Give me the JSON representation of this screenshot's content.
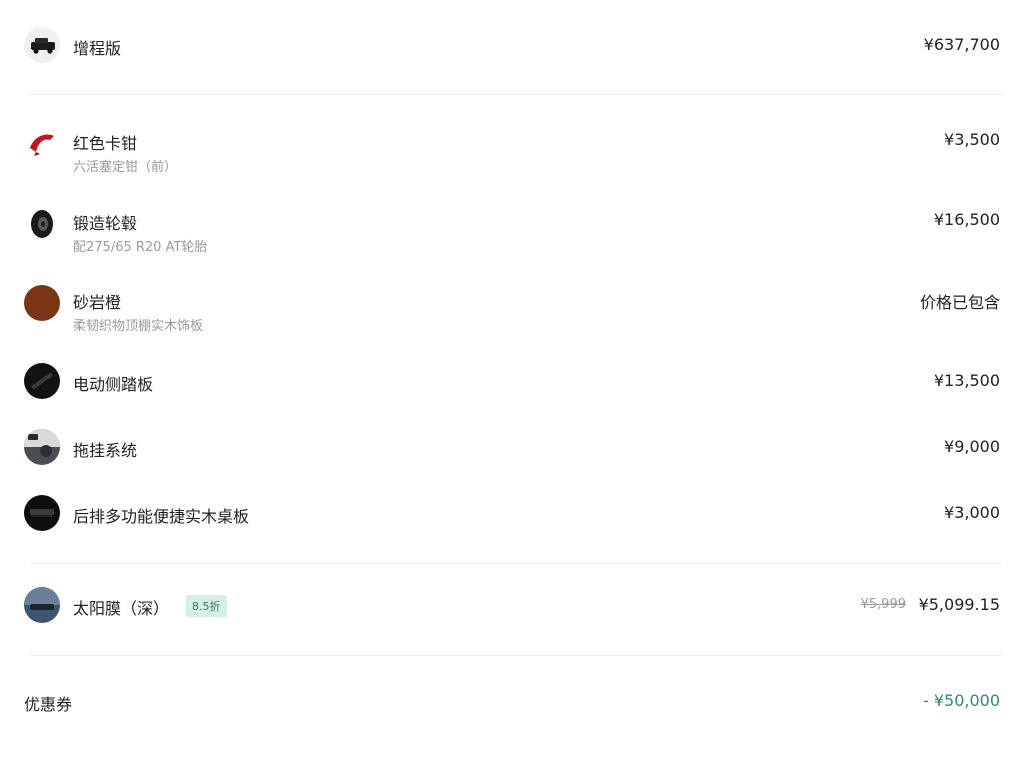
{
  "colors": {
    "accent_teal": "#2c8a78",
    "badge_bg": "#d6efe6",
    "muted_text": "#9a9a9a",
    "divider": "#ececec"
  },
  "items": [
    {
      "icon": "car-thumbnail-icon",
      "title": "增程版",
      "price": "¥637,700"
    },
    {
      "icon": "red-caliper-icon",
      "title": "红色卡钳",
      "subtitle": "六活塞定钳（前）",
      "price": "¥3,500"
    },
    {
      "icon": "forged-wheel-icon",
      "title": "锻造轮毂",
      "subtitle": "配275/65 R20 AT轮胎",
      "price": "¥16,500"
    },
    {
      "icon": "sandstone-orange-swatch-icon",
      "title": "砂岩橙",
      "subtitle": "柔韧织物顶棚实木饰板",
      "price": "价格已包含"
    },
    {
      "icon": "side-step-icon",
      "title": "电动侧踏板",
      "price": "¥13,500"
    },
    {
      "icon": "tow-hitch-icon",
      "title": "拖挂系统",
      "price": "¥9,000"
    },
    {
      "icon": "wood-table-icon",
      "title": "后排多功能便捷实木桌板",
      "price": "¥3,000"
    }
  ],
  "sun_film": {
    "icon": "sun-film-icon",
    "title": "太阳膜（深）",
    "badge": "8.5折",
    "original_price": "¥5,999",
    "price": "¥5,099.15"
  },
  "coupon": {
    "label": "优惠券",
    "price": "- ¥50,000"
  }
}
